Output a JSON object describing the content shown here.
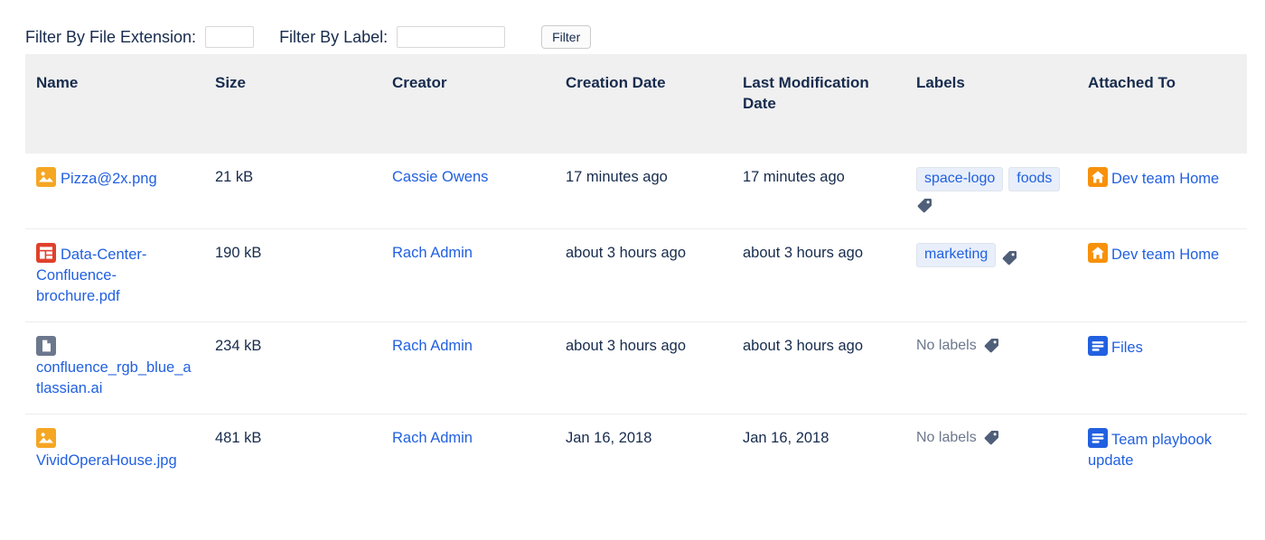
{
  "filter_bar": {
    "extension_label": "Filter By File Extension:",
    "extension_value": "",
    "extension_placeholder": "",
    "label_label": "Filter By Label:",
    "label_value": "",
    "label_placeholder": "",
    "filter_button": "Filter"
  },
  "table": {
    "columns": [
      "Name",
      "Size",
      "Creator",
      "Creation Date",
      "Last Modification Date",
      "Labels",
      "Attached To"
    ],
    "no_labels_text": "No labels",
    "rows": [
      {
        "name": "Pizza@2x.png",
        "file_icon": "image-icon",
        "size": "21 kB",
        "creator": "Cassie Owens",
        "creation_date": "17 minutes ago",
        "modification_date": "17 minutes ago",
        "labels": [
          "space-logo",
          "foods"
        ],
        "attached_to": "Dev team Home",
        "attached_icon": "home-icon"
      },
      {
        "name": "Data-Center-Confluence-brochure.pdf",
        "file_icon": "pdf-icon",
        "size": "190 kB",
        "creator": "Rach Admin",
        "creation_date": "about 3 hours ago",
        "modification_date": "about 3 hours ago",
        "labels": [
          "marketing"
        ],
        "attached_to": "Dev team Home",
        "attached_icon": "home-icon"
      },
      {
        "name": "confluence_rgb_blue_atlassian.ai",
        "file_icon": "generic-file-icon",
        "size": "234 kB",
        "creator": "Rach Admin",
        "creation_date": "about 3 hours ago",
        "modification_date": "about 3 hours ago",
        "labels": [],
        "attached_to": "Files",
        "attached_icon": "page-icon"
      },
      {
        "name": "VividOperaHouse.jpg",
        "file_icon": "image-icon",
        "size": "481 kB",
        "creator": "Rach Admin",
        "creation_date": "Jan 16, 2018",
        "modification_date": "Jan 16, 2018",
        "labels": [],
        "attached_to": "Team playbook update",
        "attached_icon": "page-icon"
      }
    ]
  },
  "colors": {
    "link": "#2160e0",
    "text": "#172b4d",
    "header_bg": "#f0f0f0",
    "label_pill_bg": "#e8effa",
    "image_icon": "#f5a623",
    "pdf_icon": "#e0402b",
    "generic_icon": "#6b778c",
    "home_icon": "#f7910b",
    "page_icon": "#2160e0",
    "tag_icon": "#505f79",
    "muted_text": "#6b778c"
  }
}
